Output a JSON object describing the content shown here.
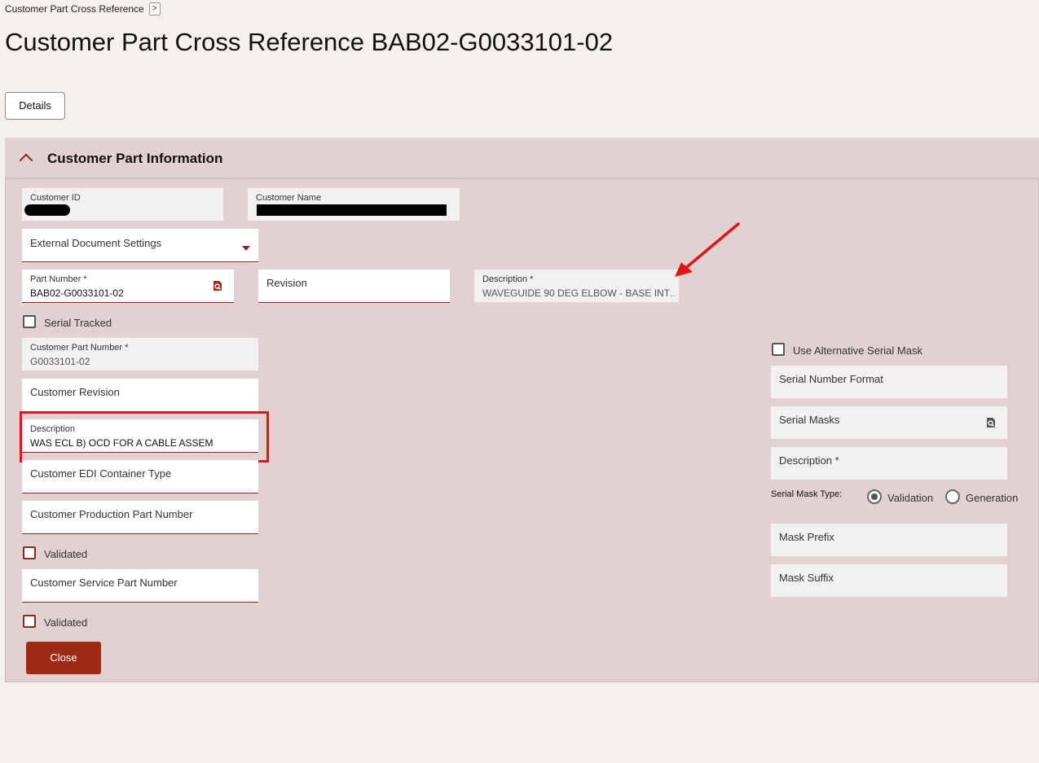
{
  "breadcrumb": {
    "label": "Customer Part Cross Reference",
    "chevron": ">"
  },
  "page": {
    "title": "Customer Part Cross Reference BAB02-G0033101-02"
  },
  "tabs": {
    "details": "Details"
  },
  "section": {
    "title": "Customer Part Information"
  },
  "fields": {
    "customer_id": {
      "label": "Customer ID"
    },
    "customer_name": {
      "label": "Customer Name"
    },
    "external_doc": {
      "label": "External Document Settings"
    },
    "part_number": {
      "label": "Part Number *",
      "value": "BAB02-G0033101-02"
    },
    "revision": {
      "label": "Revision"
    },
    "description_top": {
      "label": "Description *",
      "value": "WAVEGUIDE 90 DEG ELBOW - BASE INT…"
    },
    "serial_tracked": {
      "label": "Serial Tracked"
    },
    "customer_part_number": {
      "label": "Customer Part Number *",
      "value": "G0033101-02"
    },
    "customer_revision": {
      "label": "Customer Revision"
    },
    "description": {
      "label": "Description",
      "value": "WAS ECL B) OCD FOR A CABLE ASSEM"
    },
    "edi_container": {
      "label": "Customer EDI Container Type"
    },
    "production_part": {
      "label": "Customer Production Part Number"
    },
    "validated_1": {
      "label": "Validated"
    },
    "service_part": {
      "label": "Customer Service Part Number"
    },
    "validated_2": {
      "label": "Validated"
    }
  },
  "serial": {
    "use_alt_mask": "Use Alternative Serial Mask",
    "number_format": "Serial Number Format",
    "masks": "Serial Masks",
    "description": "Description *",
    "mask_type_label": "Serial Mask Type:",
    "opt_validation": "Validation",
    "opt_generation": "Generation",
    "selected": "Validation",
    "mask_prefix": "Mask Prefix",
    "mask_suffix": "Mask Suffix"
  },
  "actions": {
    "close": "Close"
  },
  "colors": {
    "accent": "#9c2a14",
    "panel": "#e1d2d1",
    "annotation": "#e0141b"
  }
}
